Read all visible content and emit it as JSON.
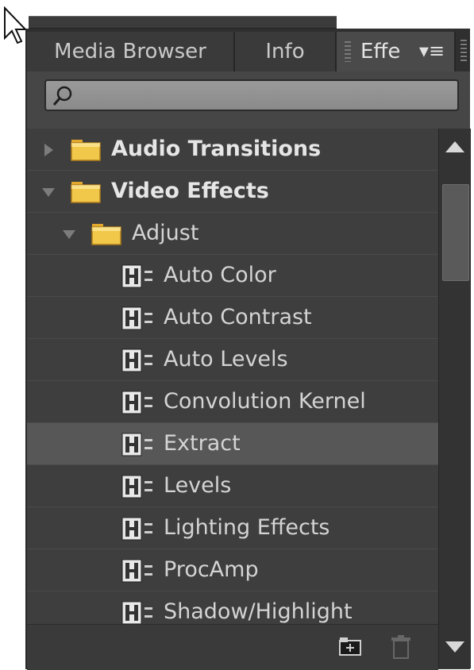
{
  "tabs": {
    "media_browser": "Media Browser",
    "info": "Info",
    "effects": "Effe"
  },
  "search": {
    "value": ""
  },
  "tree": [
    {
      "label": "Audio Transitions",
      "type": "folder",
      "level": 0,
      "expanded": false
    },
    {
      "label": "Video Effects",
      "type": "folder",
      "level": 0,
      "expanded": true
    },
    {
      "label": "Adjust",
      "type": "folder",
      "level": 1,
      "expanded": true
    },
    {
      "label": "Auto Color",
      "type": "effect",
      "level": 2
    },
    {
      "label": "Auto Contrast",
      "type": "effect",
      "level": 2
    },
    {
      "label": "Auto Levels",
      "type": "effect",
      "level": 2
    },
    {
      "label": "Convolution Kernel",
      "type": "effect",
      "level": 2
    },
    {
      "label": "Extract",
      "type": "effect",
      "level": 2,
      "selected": true
    },
    {
      "label": "Levels",
      "type": "effect",
      "level": 2
    },
    {
      "label": "Lighting Effects",
      "type": "effect",
      "level": 2
    },
    {
      "label": "ProcAmp",
      "type": "effect",
      "level": 2
    },
    {
      "label": "Shadow/Highlight",
      "type": "effect",
      "level": 2
    }
  ],
  "icons": {
    "folder": "folder-icon",
    "effect": "effect-icon",
    "new_bin": "new-bin-icon",
    "delete": "trash-icon",
    "panel_menu": "panel-menu-icon",
    "search": "search-icon"
  },
  "colors": {
    "panel_bg": "#3e3e3e",
    "selected_row": "#575757",
    "folder": "#f2c84b",
    "text": "#d4d4d4"
  }
}
